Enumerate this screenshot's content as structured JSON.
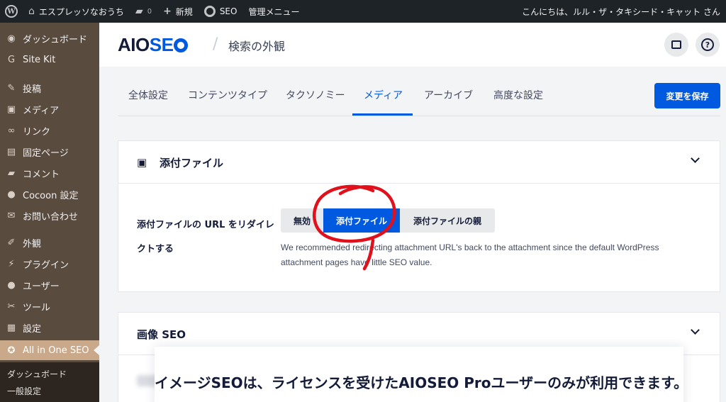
{
  "admin_bar": {
    "site_name": "エスプレッソなおうち",
    "comments_count": "0",
    "new_label": "新規",
    "seo_label": "SEO",
    "admin_menu_label": "管理メニュー",
    "greeting": "こんにちは、ルル・ザ・タキシード・キャット さん"
  },
  "sidebar": {
    "items": [
      {
        "label": "ダッシュボード",
        "icon": "dashboard-icon",
        "glyph": "◉"
      },
      {
        "label": "Site Kit",
        "icon": "site-kit-icon",
        "glyph": "G"
      },
      {
        "label": "投稿",
        "icon": "pin-icon",
        "glyph": "✎"
      },
      {
        "label": "メディア",
        "icon": "media-icon",
        "glyph": "▣"
      },
      {
        "label": "リンク",
        "icon": "link-icon",
        "glyph": "∞"
      },
      {
        "label": "固定ページ",
        "icon": "page-icon",
        "glyph": "▤"
      },
      {
        "label": "コメント",
        "icon": "comment-icon",
        "glyph": "▰"
      },
      {
        "label": "Cocoon 設定",
        "icon": "cocoon-icon",
        "glyph": "●"
      },
      {
        "label": "お問い合わせ",
        "icon": "mail-icon",
        "glyph": "✉"
      },
      {
        "label": "外観",
        "icon": "appearance-icon",
        "glyph": "✐"
      },
      {
        "label": "プラグイン",
        "icon": "plugin-icon",
        "glyph": "⚡"
      },
      {
        "label": "ユーザー",
        "icon": "user-icon",
        "glyph": "●"
      },
      {
        "label": "ツール",
        "icon": "tools-icon",
        "glyph": "✂"
      },
      {
        "label": "設定",
        "icon": "settings-icon",
        "glyph": "▦"
      },
      {
        "label": "All in One SEO",
        "icon": "aioseo-icon",
        "glyph": "✪"
      }
    ],
    "submenu": [
      "ダッシュボード",
      "一般設定"
    ]
  },
  "header": {
    "logo_part1": "AIO",
    "logo_part2": "SE",
    "logo_part3": "",
    "page_title": "検索の外観"
  },
  "tabs": [
    "全体設定",
    "コンテンツタイプ",
    "タクソノミー",
    "メディア",
    "アーカイブ",
    "高度な設定"
  ],
  "active_tab": "メディア",
  "save_button": "変更を保存",
  "attachments_card": {
    "title": "添付ファイル",
    "setting_label": "添付ファイルの URL をリダイレクトする",
    "options": [
      "無効",
      "添付ファイル",
      "添付ファイルの親"
    ],
    "selected": "添付ファイル",
    "description": "We recommended redirecting attachment URL's back to the attachment since the default WordPress attachment pages have little SEO value."
  },
  "image_seo_card": {
    "title": "画像 SEO",
    "overlay_text": "イメージSEOは、ライセンスを受けたAIOSEO Proユーザーのみが利用できます。"
  },
  "colors": {
    "accent": "#005ae0",
    "sidebar_bg": "#5a4b3f",
    "sidebar_active": "#c9a98a",
    "admin_bar_bg": "#1d2327",
    "annotation": "#e0101c"
  }
}
